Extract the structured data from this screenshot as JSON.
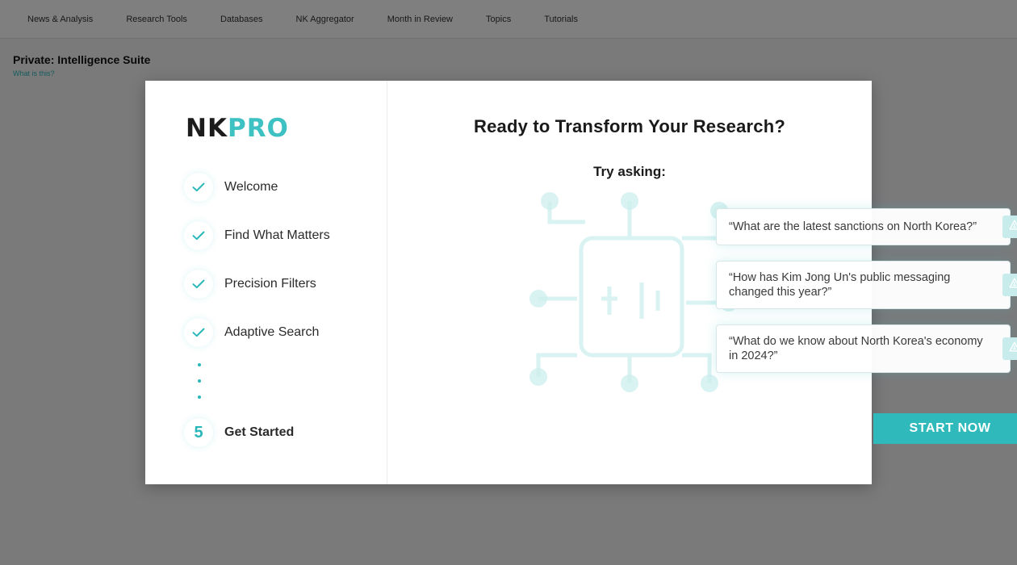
{
  "background_page": {
    "nav": [
      "News & Analysis",
      "Research Tools",
      "Databases",
      "NK Aggregator",
      "Month in Review",
      "Topics",
      "Tutorials"
    ],
    "title": "Private: Intelligence Suite",
    "subtitle": "What is this?"
  },
  "modal": {
    "logo": {
      "part1": "NK",
      "part2": "PRO"
    },
    "steps": [
      {
        "label": "Welcome",
        "status": "done"
      },
      {
        "label": "Find What Matters",
        "status": "done"
      },
      {
        "label": "Precision Filters",
        "status": "done"
      },
      {
        "label": "Adaptive Search",
        "status": "done"
      },
      {
        "number": "5",
        "label": "Get Started",
        "status": "current"
      }
    ],
    "heading": "Ready to Transform Your Research?",
    "subheading": "Try asking:",
    "queries": [
      "“What are the latest sanctions on North Korea?”",
      "“How has Kim Jong Un's public messaging changed this year?”",
      "“What do we know about North Korea's economy in 2024?”"
    ],
    "start_label": "START NOW"
  },
  "colors": {
    "accent": "#2fb9ba",
    "logo_dark": "#1c1c1c",
    "logo_accent": "#3ec1c3",
    "query_button_bg": "#c8ecec"
  },
  "icons": {
    "step_done": "checkmark-icon",
    "query_action": "triangle-alert-icon"
  }
}
